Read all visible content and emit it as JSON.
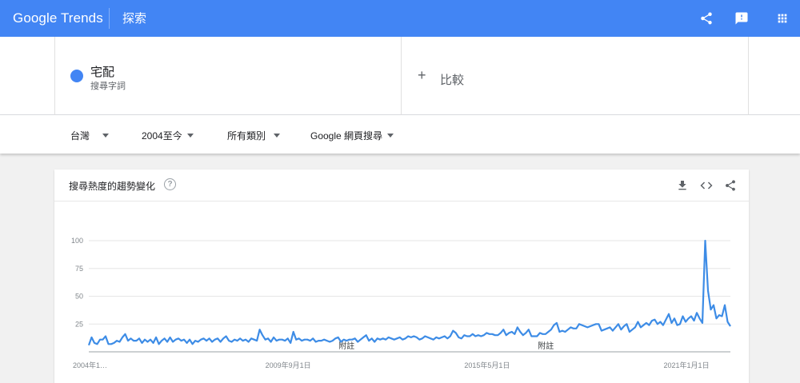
{
  "header": {
    "logo_google": "Google",
    "logo_trends": "Trends",
    "title": "探索",
    "icons": [
      "share-icon",
      "feedback-icon",
      "apps-icon"
    ]
  },
  "term": {
    "name": "宅配",
    "type": "搜尋字詞",
    "color": "#4285f4"
  },
  "compare": {
    "label": "比較"
  },
  "filters": {
    "region": "台灣",
    "time": "2004至今",
    "category": "所有類別",
    "property": "Google 網頁搜尋"
  },
  "card": {
    "title": "搜尋熱度的趨勢變化",
    "help": "?"
  },
  "chart_data": {
    "type": "line",
    "ylim": [
      0,
      100
    ],
    "yticks": [
      25,
      50,
      75,
      100
    ],
    "line_color": "#3d8ce6",
    "xtick_labels": [
      {
        "label": "2004年1…",
        "year": 2004.0
      },
      {
        "label": "2009年9月1日",
        "year": 2009.67
      },
      {
        "label": "2015年5月1日",
        "year": 2015.33
      },
      {
        "label": "2021年1月1日",
        "year": 2021.0
      }
    ],
    "notes": [
      {
        "label": "附註",
        "year": 2011.33
      },
      {
        "label": "附註",
        "year": 2017.0
      }
    ],
    "x_start": 2004.0,
    "x_end": 2022.25,
    "values": [
      6,
      13,
      8,
      7,
      11,
      11,
      14,
      7,
      7,
      8,
      10,
      9,
      13,
      16,
      10,
      12,
      10,
      10,
      12,
      8,
      11,
      9,
      11,
      8,
      13,
      7,
      10,
      12,
      9,
      13,
      9,
      11,
      12,
      10,
      11,
      8,
      11,
      7,
      10,
      9,
      11,
      12,
      10,
      12,
      9,
      11,
      12,
      9,
      12,
      14,
      10,
      9,
      11,
      10,
      12,
      10,
      11,
      9,
      12,
      11,
      10,
      20,
      15,
      11,
      12,
      9,
      13,
      10,
      11,
      11,
      10,
      12,
      8,
      18,
      11,
      12,
      10,
      11,
      11,
      10,
      12,
      9,
      10,
      10,
      11,
      10,
      9,
      10,
      12,
      13,
      9,
      11,
      10,
      11,
      11,
      12,
      9,
      11,
      13,
      15,
      10,
      12,
      9,
      12,
      11,
      12,
      11,
      13,
      12,
      11,
      12,
      13,
      11,
      12,
      14,
      13,
      14,
      13,
      11,
      12,
      14,
      13,
      12,
      11,
      13,
      12,
      13,
      14,
      12,
      14,
      19,
      17,
      13,
      12,
      15,
      14,
      14,
      16,
      14,
      15,
      14,
      15,
      17,
      16,
      16,
      15,
      15,
      17,
      20,
      15,
      17,
      18,
      16,
      22,
      18,
      15,
      17,
      20,
      14,
      14,
      14,
      17,
      16,
      16,
      18,
      20,
      24,
      26,
      18,
      19,
      18,
      20,
      22,
      21,
      21,
      25,
      24,
      23,
      22,
      23,
      24,
      25,
      25,
      19,
      20,
      21,
      22,
      19,
      22,
      25,
      20,
      23,
      25,
      18,
      20,
      22,
      27,
      22,
      24,
      26,
      24,
      28,
      29,
      25,
      27,
      24,
      29,
      34,
      26,
      30,
      24,
      25,
      32,
      27,
      30,
      32,
      28,
      35,
      30,
      26,
      100,
      55,
      38,
      42,
      30,
      33,
      32,
      42,
      27,
      23
    ]
  }
}
